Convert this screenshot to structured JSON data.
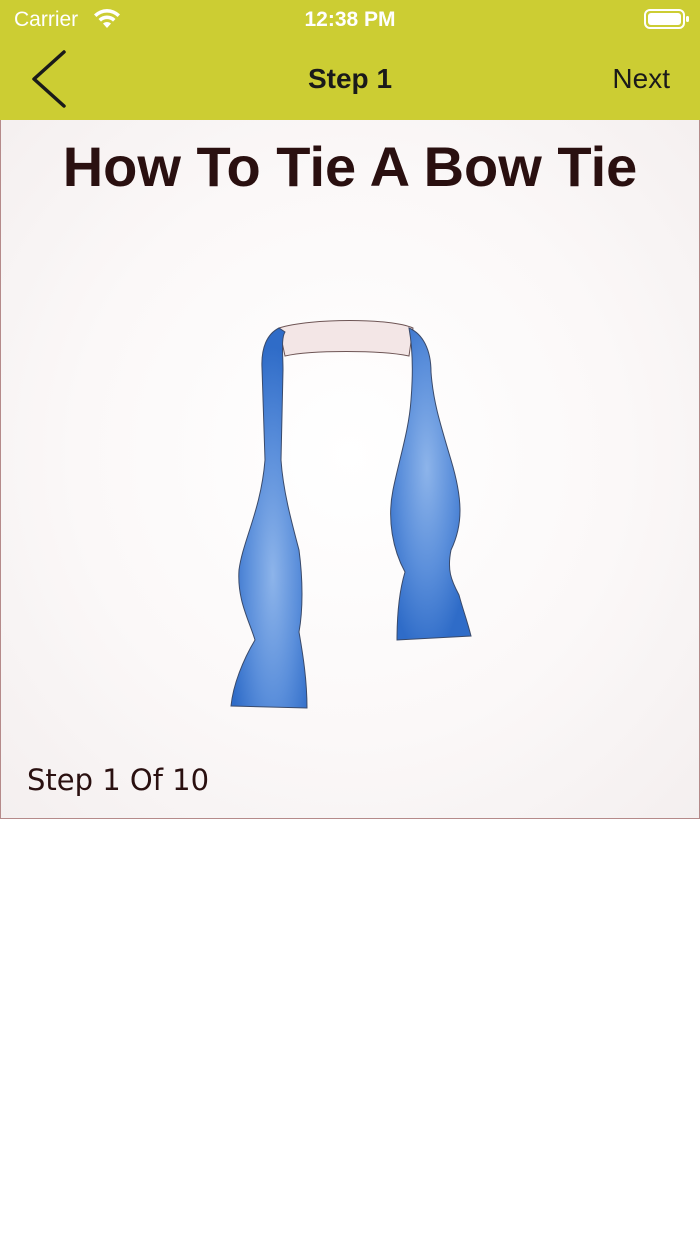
{
  "status_bar": {
    "carrier": "Carrier",
    "time": "12:38 PM",
    "wifi_icon": "wifi-icon",
    "battery_icon": "battery-icon"
  },
  "nav_bar": {
    "back_icon": "chevron-left-icon",
    "title": "Step 1",
    "next_label": "Next",
    "background_color": "#cccd33"
  },
  "card": {
    "title": "How To Tie A Bow Tie",
    "step_counter": "Step 1 Of 10",
    "illustration": "bow-tie-untied-draped-around-neck",
    "tie_color": "#3f7fd0",
    "border_color": "#b58a8a"
  }
}
